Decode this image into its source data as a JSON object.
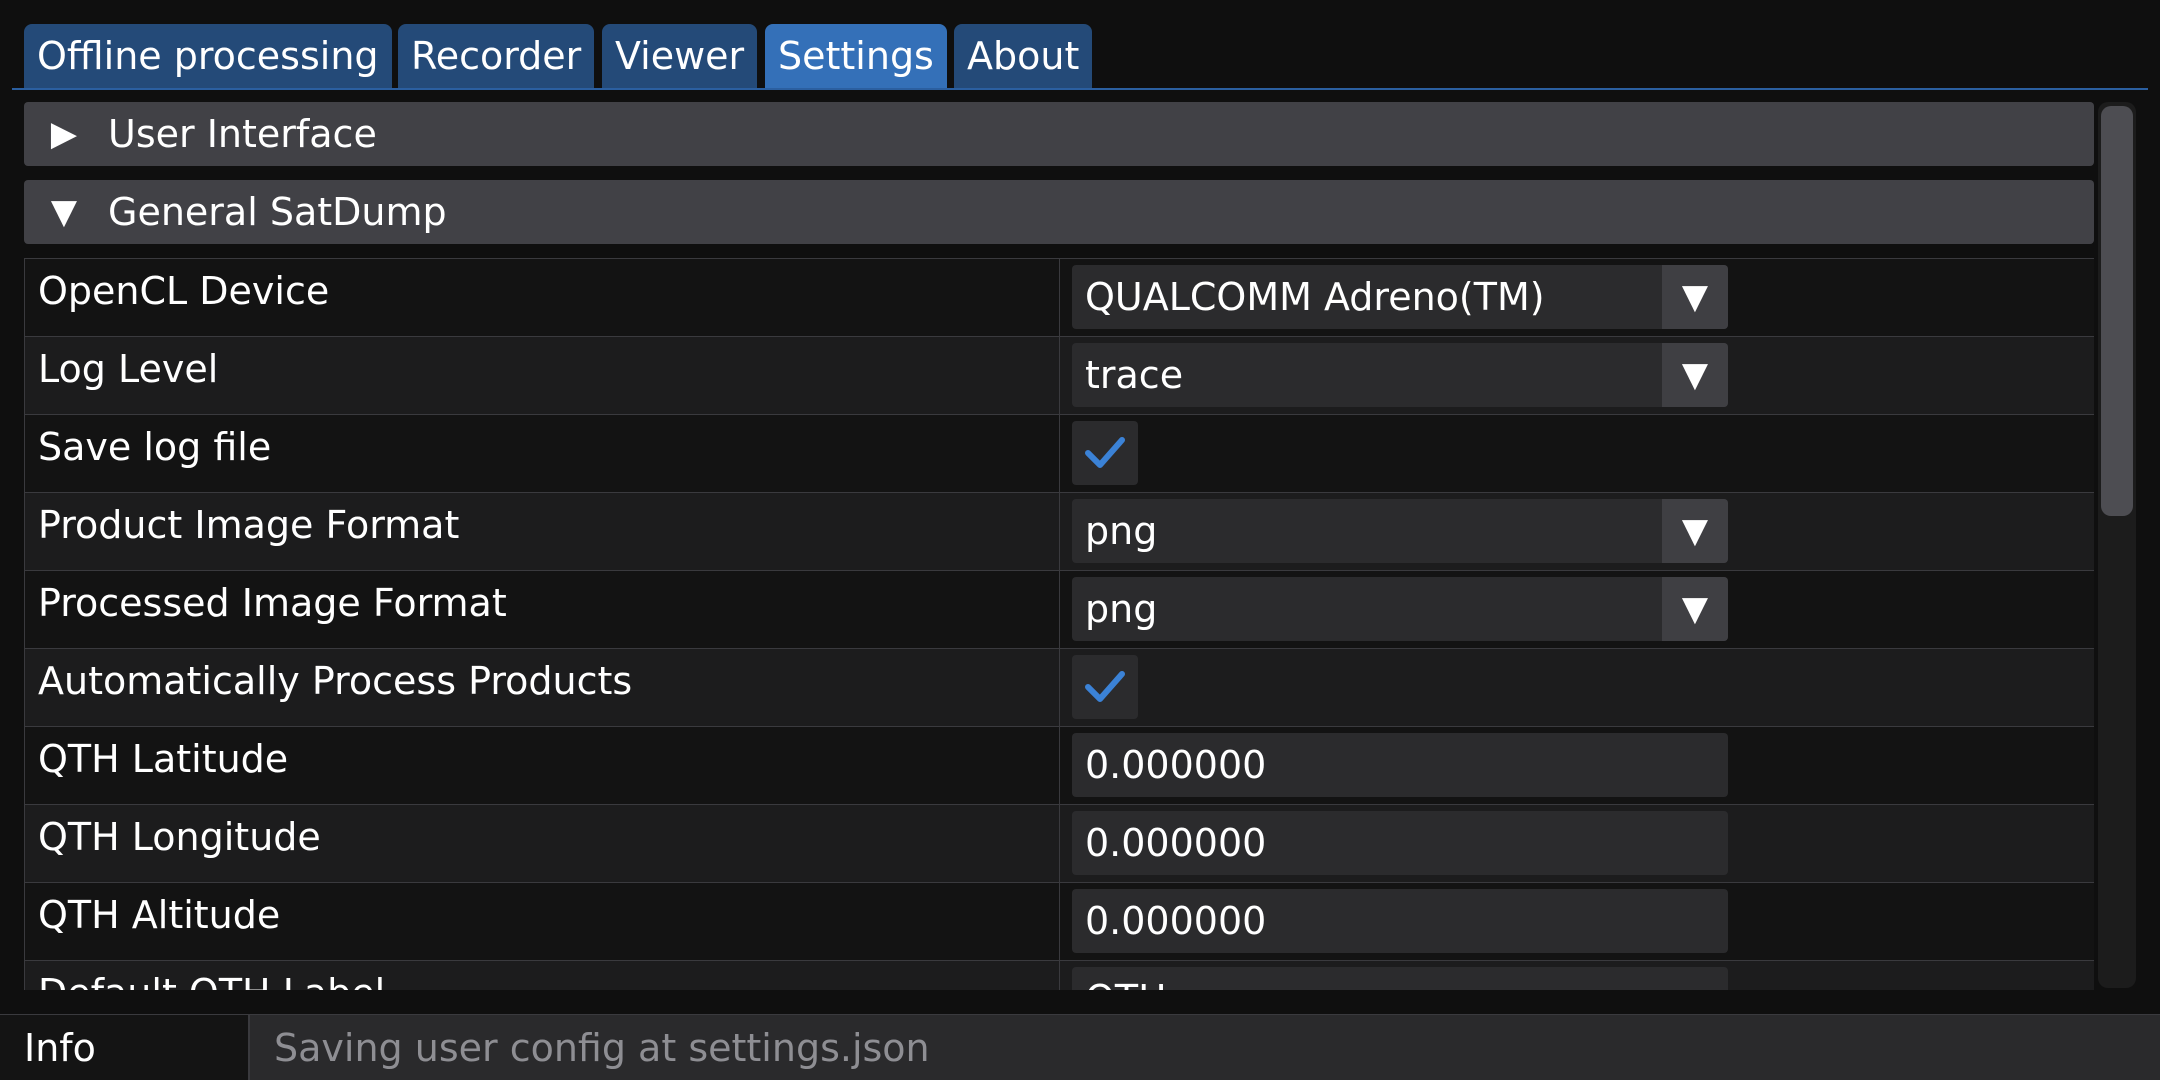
{
  "tabs": [
    {
      "label": "Offline processing",
      "active": false
    },
    {
      "label": "Recorder",
      "active": false
    },
    {
      "label": "Viewer",
      "active": false
    },
    {
      "label": "Settings",
      "active": true
    },
    {
      "label": "About",
      "active": false
    }
  ],
  "sections": {
    "user_interface": {
      "title": "User Interface",
      "expanded": false
    },
    "general": {
      "title": "General SatDump",
      "expanded": true
    }
  },
  "settings": {
    "opencl_device": {
      "label": "OpenCL Device",
      "value": "QUALCOMM Adreno(TM)"
    },
    "log_level": {
      "label": "Log Level",
      "value": "trace"
    },
    "save_log_file": {
      "label": "Save log file",
      "checked": true
    },
    "product_image_format": {
      "label": "Product Image Format",
      "value": "png"
    },
    "processed_image_format": {
      "label": "Processed Image Format",
      "value": "png"
    },
    "auto_process_products": {
      "label": "Automatically Process Products",
      "checked": true
    },
    "qth_latitude": {
      "label": "QTH Latitude",
      "value": "0.000000"
    },
    "qth_longitude": {
      "label": "QTH Longitude",
      "value": "0.000000"
    },
    "qth_altitude": {
      "label": "QTH Altitude",
      "value": "0.000000"
    },
    "default_qth_label": {
      "label": "Default QTH Label",
      "value": "QTH"
    }
  },
  "icons": {
    "collapsed": "triangle-right-icon",
    "expanded": "triangle-down-icon",
    "dropdown": "triangle-down-icon",
    "check": "checkmark-icon"
  },
  "colors": {
    "tab": "#244a78",
    "tab_active": "#3470b8",
    "check": "#3b82d6",
    "status_text": "#8e8e93"
  },
  "status": {
    "tag": "Info",
    "message": "Saving user config at settings.json"
  }
}
